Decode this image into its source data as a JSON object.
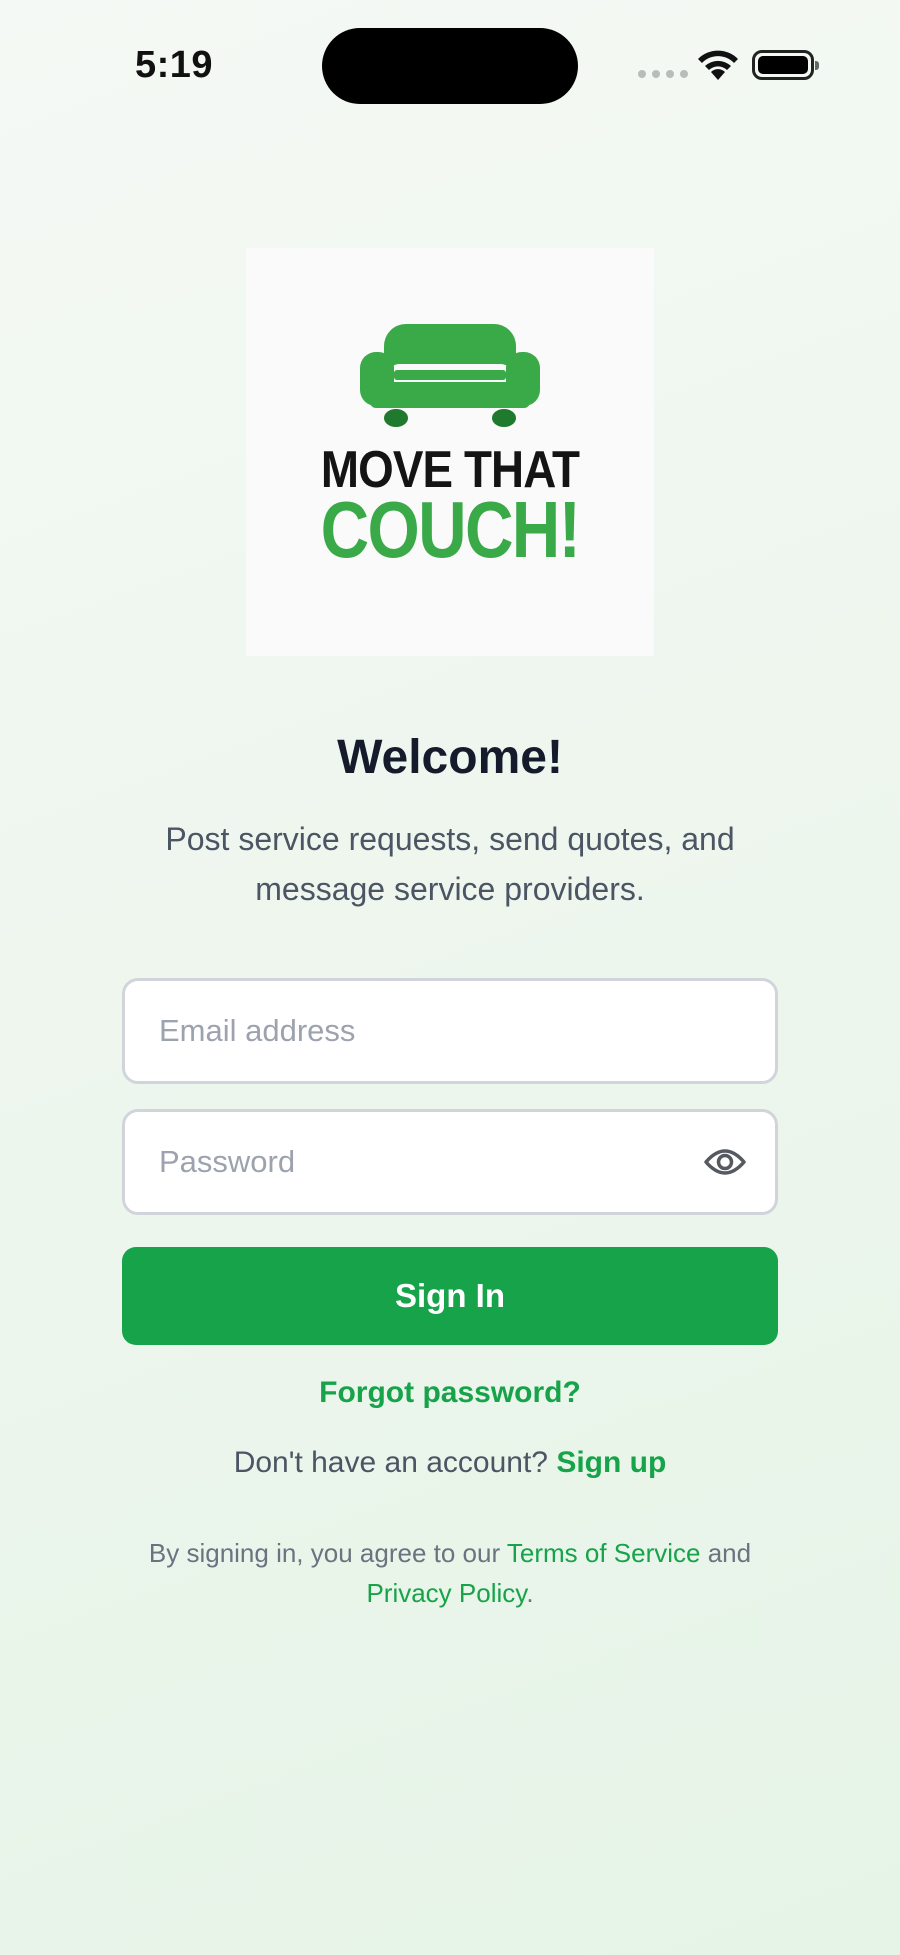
{
  "status_bar": {
    "time": "5:19"
  },
  "logo": {
    "line1": "MOVE THAT",
    "line2": "COUCH!",
    "icon": "couch-icon",
    "brand_color": "#3aa948"
  },
  "welcome": {
    "title": "Welcome!",
    "subtitle": "Post service requests, send quotes, and message service providers."
  },
  "form": {
    "email_placeholder": "Email address",
    "email_value": "",
    "password_placeholder": "Password",
    "password_value": "",
    "password_toggle_icon": "eye-icon",
    "sign_in_label": "Sign In",
    "forgot_password": "Forgot password?"
  },
  "signup": {
    "prompt": "Don't have an account?",
    "link": "Sign up"
  },
  "legal": {
    "prefix": "By signing in, you agree to our",
    "terms": "Terms of Service",
    "and": "and",
    "privacy": "Privacy Policy",
    "suffix": "."
  },
  "colors": {
    "accent": "#16a34a",
    "title": "#151b2b",
    "body_text": "#4b5563"
  }
}
